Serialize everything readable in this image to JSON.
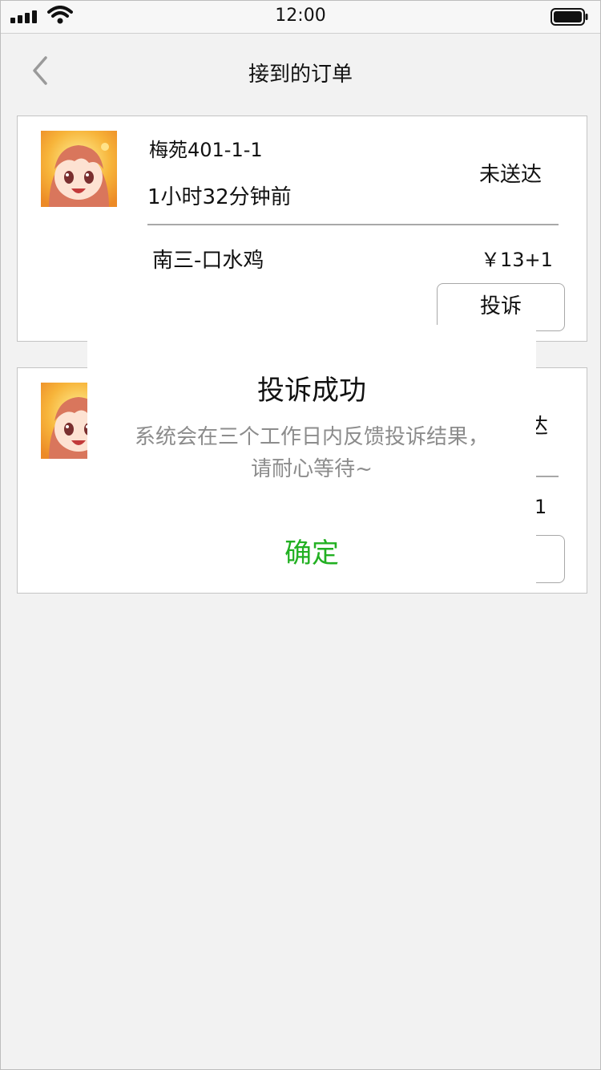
{
  "status_bar": {
    "time": "12:00"
  },
  "nav": {
    "title": "接到的订单"
  },
  "orders": [
    {
      "address": "梅苑401-1-1",
      "time_ago": "1小时32分钟前",
      "status": "未送达",
      "dish": "南三-口水鸡",
      "price": "￥13+1",
      "complain_label": "投诉"
    },
    {
      "address": "",
      "time_ago": "",
      "status": "达",
      "dish": "",
      "price": "1",
      "complain_label": ""
    }
  ],
  "dialog": {
    "title": "投诉成功",
    "message": "系统会在三个工作日内反馈投诉结果，请耐心等待~",
    "confirm": "确定"
  },
  "colors": {
    "confirm": "#22b022",
    "background": "#f2f2f2"
  }
}
